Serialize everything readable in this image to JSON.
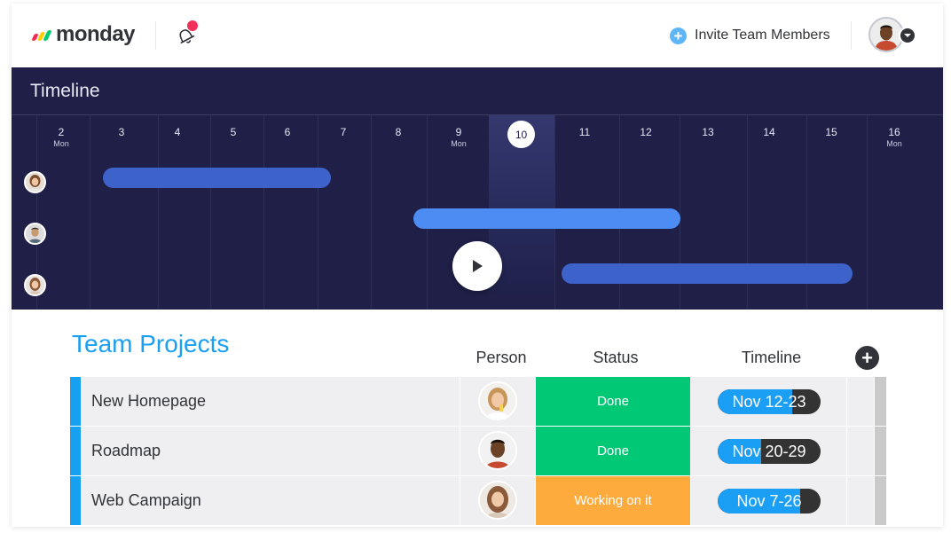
{
  "header": {
    "logo_text": "monday",
    "invite_label": "Invite Team Members"
  },
  "timeline": {
    "title": "Timeline",
    "today": "10",
    "days": [
      {
        "num": "2",
        "dow": "Mon"
      },
      {
        "num": "3",
        "dow": ""
      },
      {
        "num": "4",
        "dow": ""
      },
      {
        "num": "5",
        "dow": ""
      },
      {
        "num": "6",
        "dow": ""
      },
      {
        "num": "7",
        "dow": ""
      },
      {
        "num": "8",
        "dow": ""
      },
      {
        "num": "9",
        "dow": "Mon"
      },
      {
        "num": "11",
        "dow": ""
      },
      {
        "num": "12",
        "dow": ""
      },
      {
        "num": "13",
        "dow": ""
      },
      {
        "num": "14",
        "dow": ""
      },
      {
        "num": "15",
        "dow": ""
      },
      {
        "num": "16",
        "dow": "Mon"
      }
    ],
    "bar_colors": [
      "#3d62c9",
      "#4d8cf2",
      "#3d62c9"
    ]
  },
  "projects": {
    "title": "Team Projects",
    "columns": {
      "person": "Person",
      "status": "Status",
      "timeline": "Timeline"
    },
    "rows": [
      {
        "name": "New Homepage",
        "status": "Done",
        "status_color": "#00c875",
        "timeline": "Nov 12-23",
        "progress": 0.72
      },
      {
        "name": "Roadmap",
        "status": "Done",
        "status_color": "#00c875",
        "timeline": "Nov 20-29",
        "progress": 0.42
      },
      {
        "name": "Web Campaign",
        "status": "Working on it",
        "status_color": "#fdab3d",
        "timeline": "Nov 7-26",
        "progress": 0.8
      }
    ]
  }
}
